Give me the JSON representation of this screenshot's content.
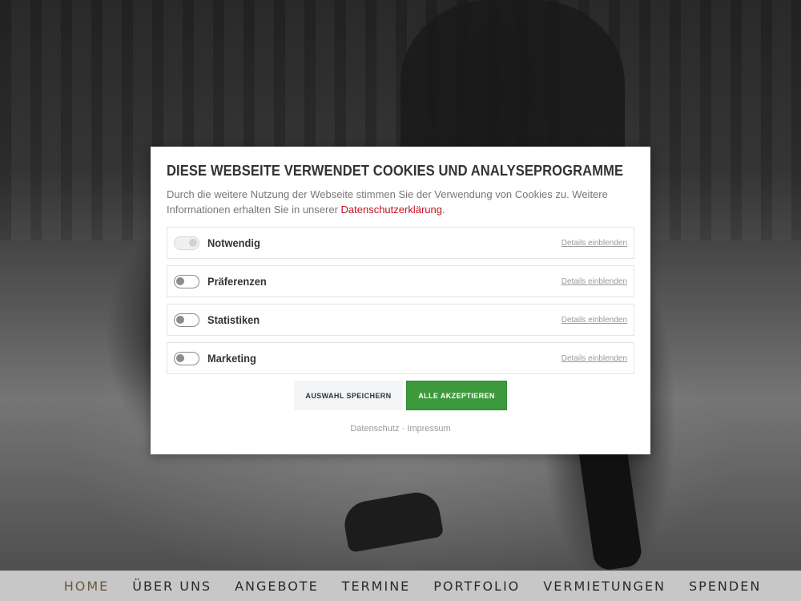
{
  "dialog": {
    "title": "DIESE WEBSEITE VERWENDET COOKIES UND ANALYSEPROGRAMME",
    "intro_text": "Durch die weitere Nutzung der Webseite stimmen Sie der Verwendung von Cookies zu. Weitere Informationen erhalten Sie in unserer ",
    "intro_link": "Datenschutzerklärung",
    "intro_end": ".",
    "options": [
      {
        "label": "Notwendig",
        "details": "Details einblenden",
        "enabled": true,
        "locked": true
      },
      {
        "label": "Präferenzen",
        "details": "Details einblenden",
        "enabled": false
      },
      {
        "label": "Statistiken",
        "details": "Details einblenden",
        "enabled": false
      },
      {
        "label": "Marketing",
        "details": "Details einblenden",
        "enabled": false
      }
    ],
    "save_label": "AUSWAHL SPEICHERN",
    "accept_label": "ALLE AKZEPTIEREN",
    "footer": {
      "privacy": "Datenschutz",
      "separator": " · ",
      "imprint": "Impressum"
    },
    "accent_color": "#c4121e",
    "accept_color": "#3c9a3c"
  },
  "nav": {
    "items": [
      "HOME",
      "ÜBER UNS",
      "ANGEBOTE",
      "TERMINE",
      "PORTFOLIO",
      "VERMIETUNGEN",
      "SPENDEN"
    ],
    "active": "HOME"
  }
}
